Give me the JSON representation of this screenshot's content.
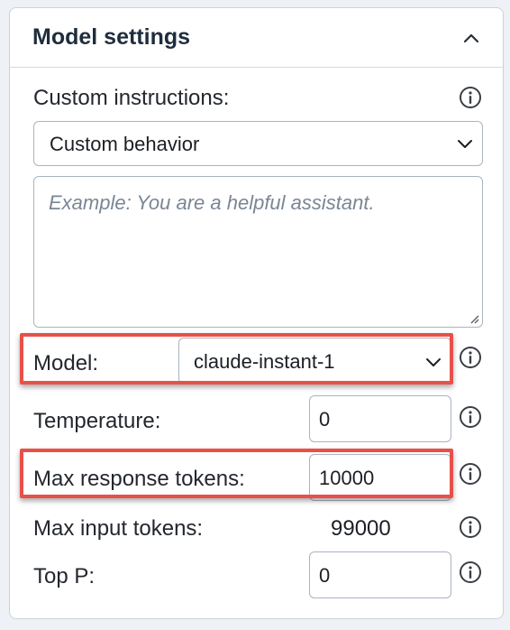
{
  "panel": {
    "title": "Model settings",
    "collapse_icon": "chevron-up-icon"
  },
  "custom_instructions": {
    "label": "Custom instructions:",
    "selected": "Custom behavior",
    "textarea_placeholder": "Example: You are a helpful assistant."
  },
  "model": {
    "label": "Model:",
    "selected": "claude-instant-1"
  },
  "temperature": {
    "label": "Temperature:",
    "value": "0"
  },
  "max_response_tokens": {
    "label": "Max response tokens:",
    "value": "10000"
  },
  "max_input_tokens": {
    "label": "Max input tokens:",
    "value": "99000"
  },
  "top_p": {
    "label": "Top P:",
    "value": "0"
  },
  "colors": {
    "highlight": "#e8504a",
    "title": "#1e2d3d",
    "border": "#a9b4c2"
  },
  "icons": {
    "info": "info-circle-icon",
    "chevron_down": "chevron-down-icon",
    "chevron_up": "chevron-up-icon"
  }
}
